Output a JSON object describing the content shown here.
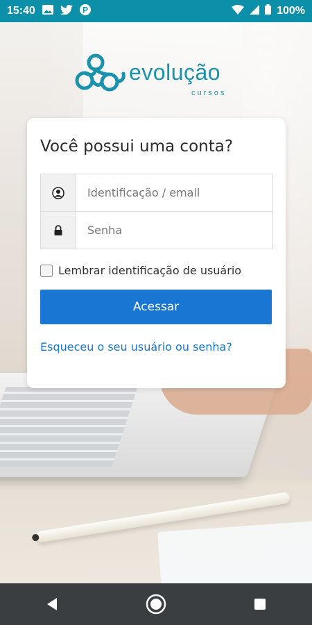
{
  "status_bar": {
    "time": "15:40",
    "battery": "100%",
    "icons": [
      "image-icon",
      "twitter-icon",
      "p-icon",
      "wifi-icon",
      "signal-icon",
      "battery-icon"
    ]
  },
  "brand": {
    "name": "evolução",
    "sub": "cursos",
    "color": "#1993ad"
  },
  "login": {
    "title": "Você possui uma conta?",
    "username_placeholder": "Identificação / email",
    "password_placeholder": "Senha",
    "remember_label": "Lembrar identificação de usuário",
    "remember_checked": false,
    "submit_label": "Acessar",
    "forgot_link": "Esqueceu o seu usuário ou senha?",
    "accent": "#1977d3"
  },
  "nav": {
    "icons": [
      "back-icon",
      "home-icon",
      "recents-icon"
    ]
  }
}
